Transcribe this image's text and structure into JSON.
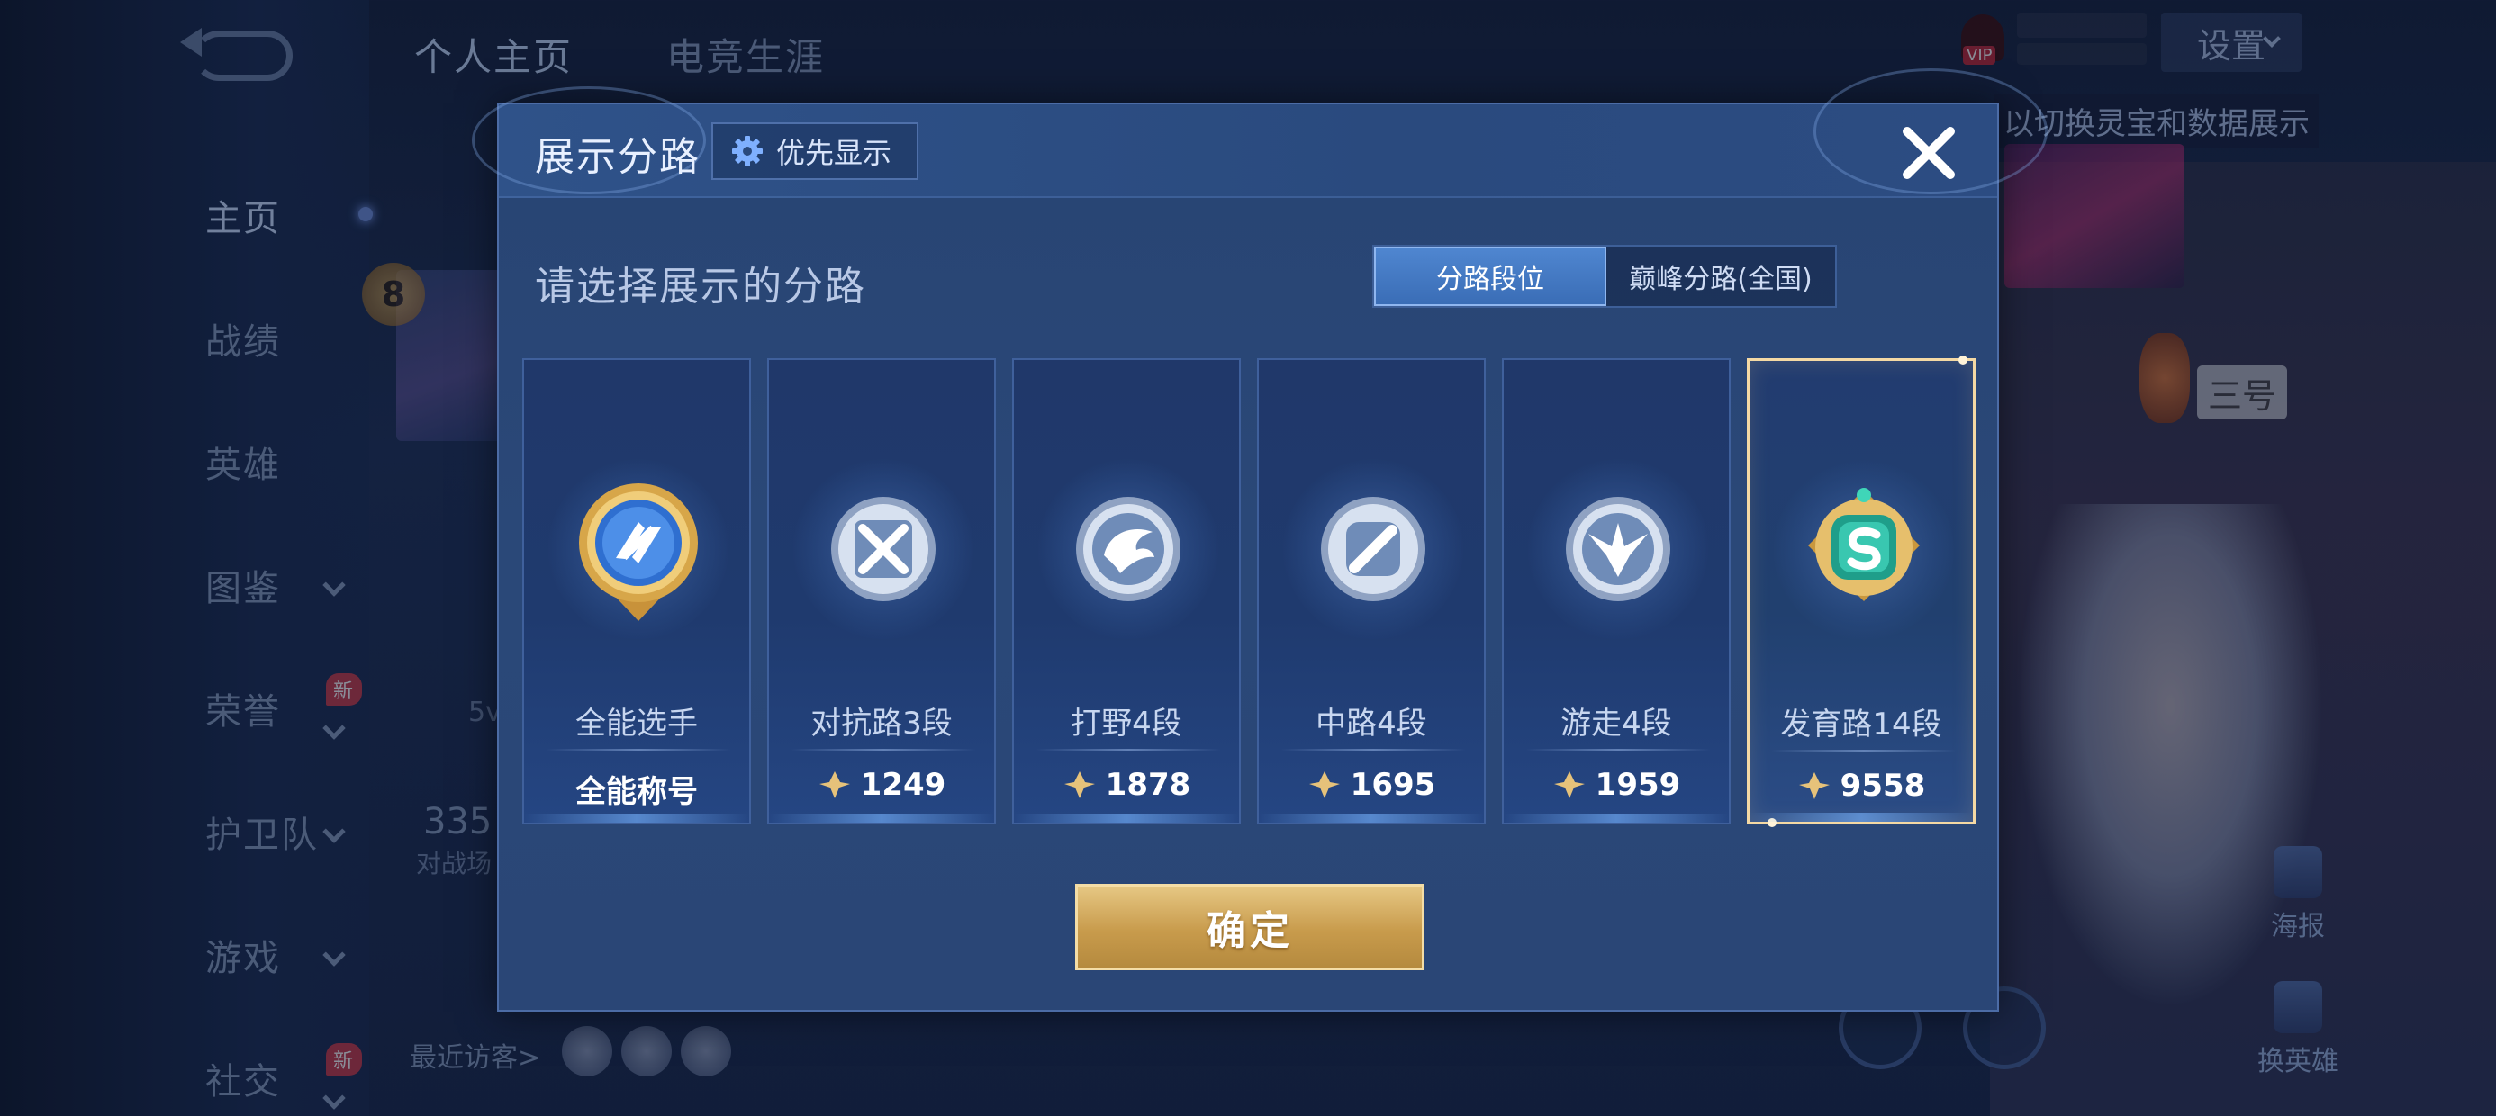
{
  "background": {
    "top_tabs": [
      "个人主页",
      "电竞生涯"
    ],
    "side_menu": [
      {
        "label": "主页",
        "active": true,
        "chevron": false,
        "new": false
      },
      {
        "label": "战绩",
        "active": false,
        "chevron": false,
        "new": false
      },
      {
        "label": "英雄",
        "active": false,
        "chevron": false,
        "new": false
      },
      {
        "label": "图鉴",
        "active": false,
        "chevron": true,
        "new": false
      },
      {
        "label": "荣誉",
        "active": false,
        "chevron": true,
        "new": true
      },
      {
        "label": "护卫队",
        "active": false,
        "chevron": true,
        "new": false
      },
      {
        "label": "游戏",
        "active": false,
        "chevron": true,
        "new": false
      },
      {
        "label": "社交",
        "active": false,
        "chevron": true,
        "new": true
      }
    ],
    "new_badge": "新",
    "level": "8",
    "stat_partial": "335",
    "stat_sub_partial": "对战场",
    "stat_5v_partial": "5v",
    "vip_label": "VIP",
    "settings_label": "设置",
    "hint_text": "以切换灵宝和数据展示",
    "sign_text": "三号",
    "recent_visitors": "最近访客>",
    "poster_label": "海报",
    "switch_hero_label": "换英雄"
  },
  "modal": {
    "title": "展示分路",
    "priority_button": "优先显示",
    "subtitle": "请选择展示的分路",
    "toggle": [
      {
        "label": "分路段位",
        "active": true
      },
      {
        "label": "巅峰分路(全国)",
        "active": false
      }
    ],
    "cards": [
      {
        "title": "全能选手",
        "value": "全能称号",
        "icon": "all-round-medal-icon",
        "points": false,
        "selected": false
      },
      {
        "title": "对抗路3段",
        "value": "1249",
        "icon": "clash-lane-medal-icon",
        "points": true,
        "selected": false
      },
      {
        "title": "打野4段",
        "value": "1878",
        "icon": "jungle-medal-icon",
        "points": true,
        "selected": false
      },
      {
        "title": "中路4段",
        "value": "1695",
        "icon": "mid-lane-medal-icon",
        "points": true,
        "selected": false
      },
      {
        "title": "游走4段",
        "value": "1959",
        "icon": "roam-medal-icon",
        "points": true,
        "selected": false
      },
      {
        "title": "发育路14段",
        "value": "9558",
        "icon": "farm-lane-medal-icon",
        "points": true,
        "selected": true
      }
    ],
    "confirm_button": "确定"
  },
  "colors": {
    "modal_bg": "#2a4878",
    "toggle_active": "#4f86d0",
    "selected_border": "#f4d9a4",
    "confirm_gold": "#c89b4c",
    "medal_gold": "#e0b257",
    "medal_silver": "#b8c6dc",
    "medal_teal": "#2fb7a0"
  }
}
